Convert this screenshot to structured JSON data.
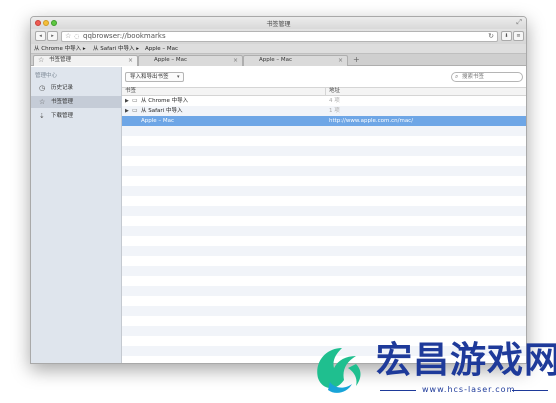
{
  "window": {
    "title": "书签管理"
  },
  "toolbar": {
    "back": "◂",
    "forward": "▸",
    "url": "qqbrowser://bookmarks",
    "download": "⬇",
    "menu": "≡"
  },
  "bookmarks_bar": [
    {
      "label": "从 Chrome 中导入 ▸"
    },
    {
      "label": "从 Safari 中导入 ▸"
    },
    {
      "label": "Apple – Mac"
    }
  ],
  "tabs": [
    {
      "label": "书签管理"
    },
    {
      "label": "Apple – Mac"
    },
    {
      "label": "Apple – Mac"
    }
  ],
  "sidebar": {
    "heading": "管理中心",
    "items": [
      {
        "label": "历史记录"
      },
      {
        "label": "书签管理"
      },
      {
        "label": "下载管理"
      }
    ]
  },
  "main": {
    "dropdown_label": "导入和导出书签",
    "search_placeholder": "搜索书签",
    "columns": {
      "name": "书签",
      "address": "地址"
    },
    "rows": [
      {
        "name": "从 Chrome 中导入",
        "address": "4 项"
      },
      {
        "name": "从 Safari 中导入",
        "address": "1 项"
      },
      {
        "name": "Apple – Mac",
        "address": "http://www.apple.com.cn/mac/"
      }
    ]
  },
  "watermark": {
    "title": "宏昌游戏网",
    "url": "www.hcs-laser.com"
  },
  "colors": {
    "selected_row": "#6ea6e6",
    "sidebar_bg": "#dfe5ed",
    "watermark": "#1e3a9a"
  }
}
